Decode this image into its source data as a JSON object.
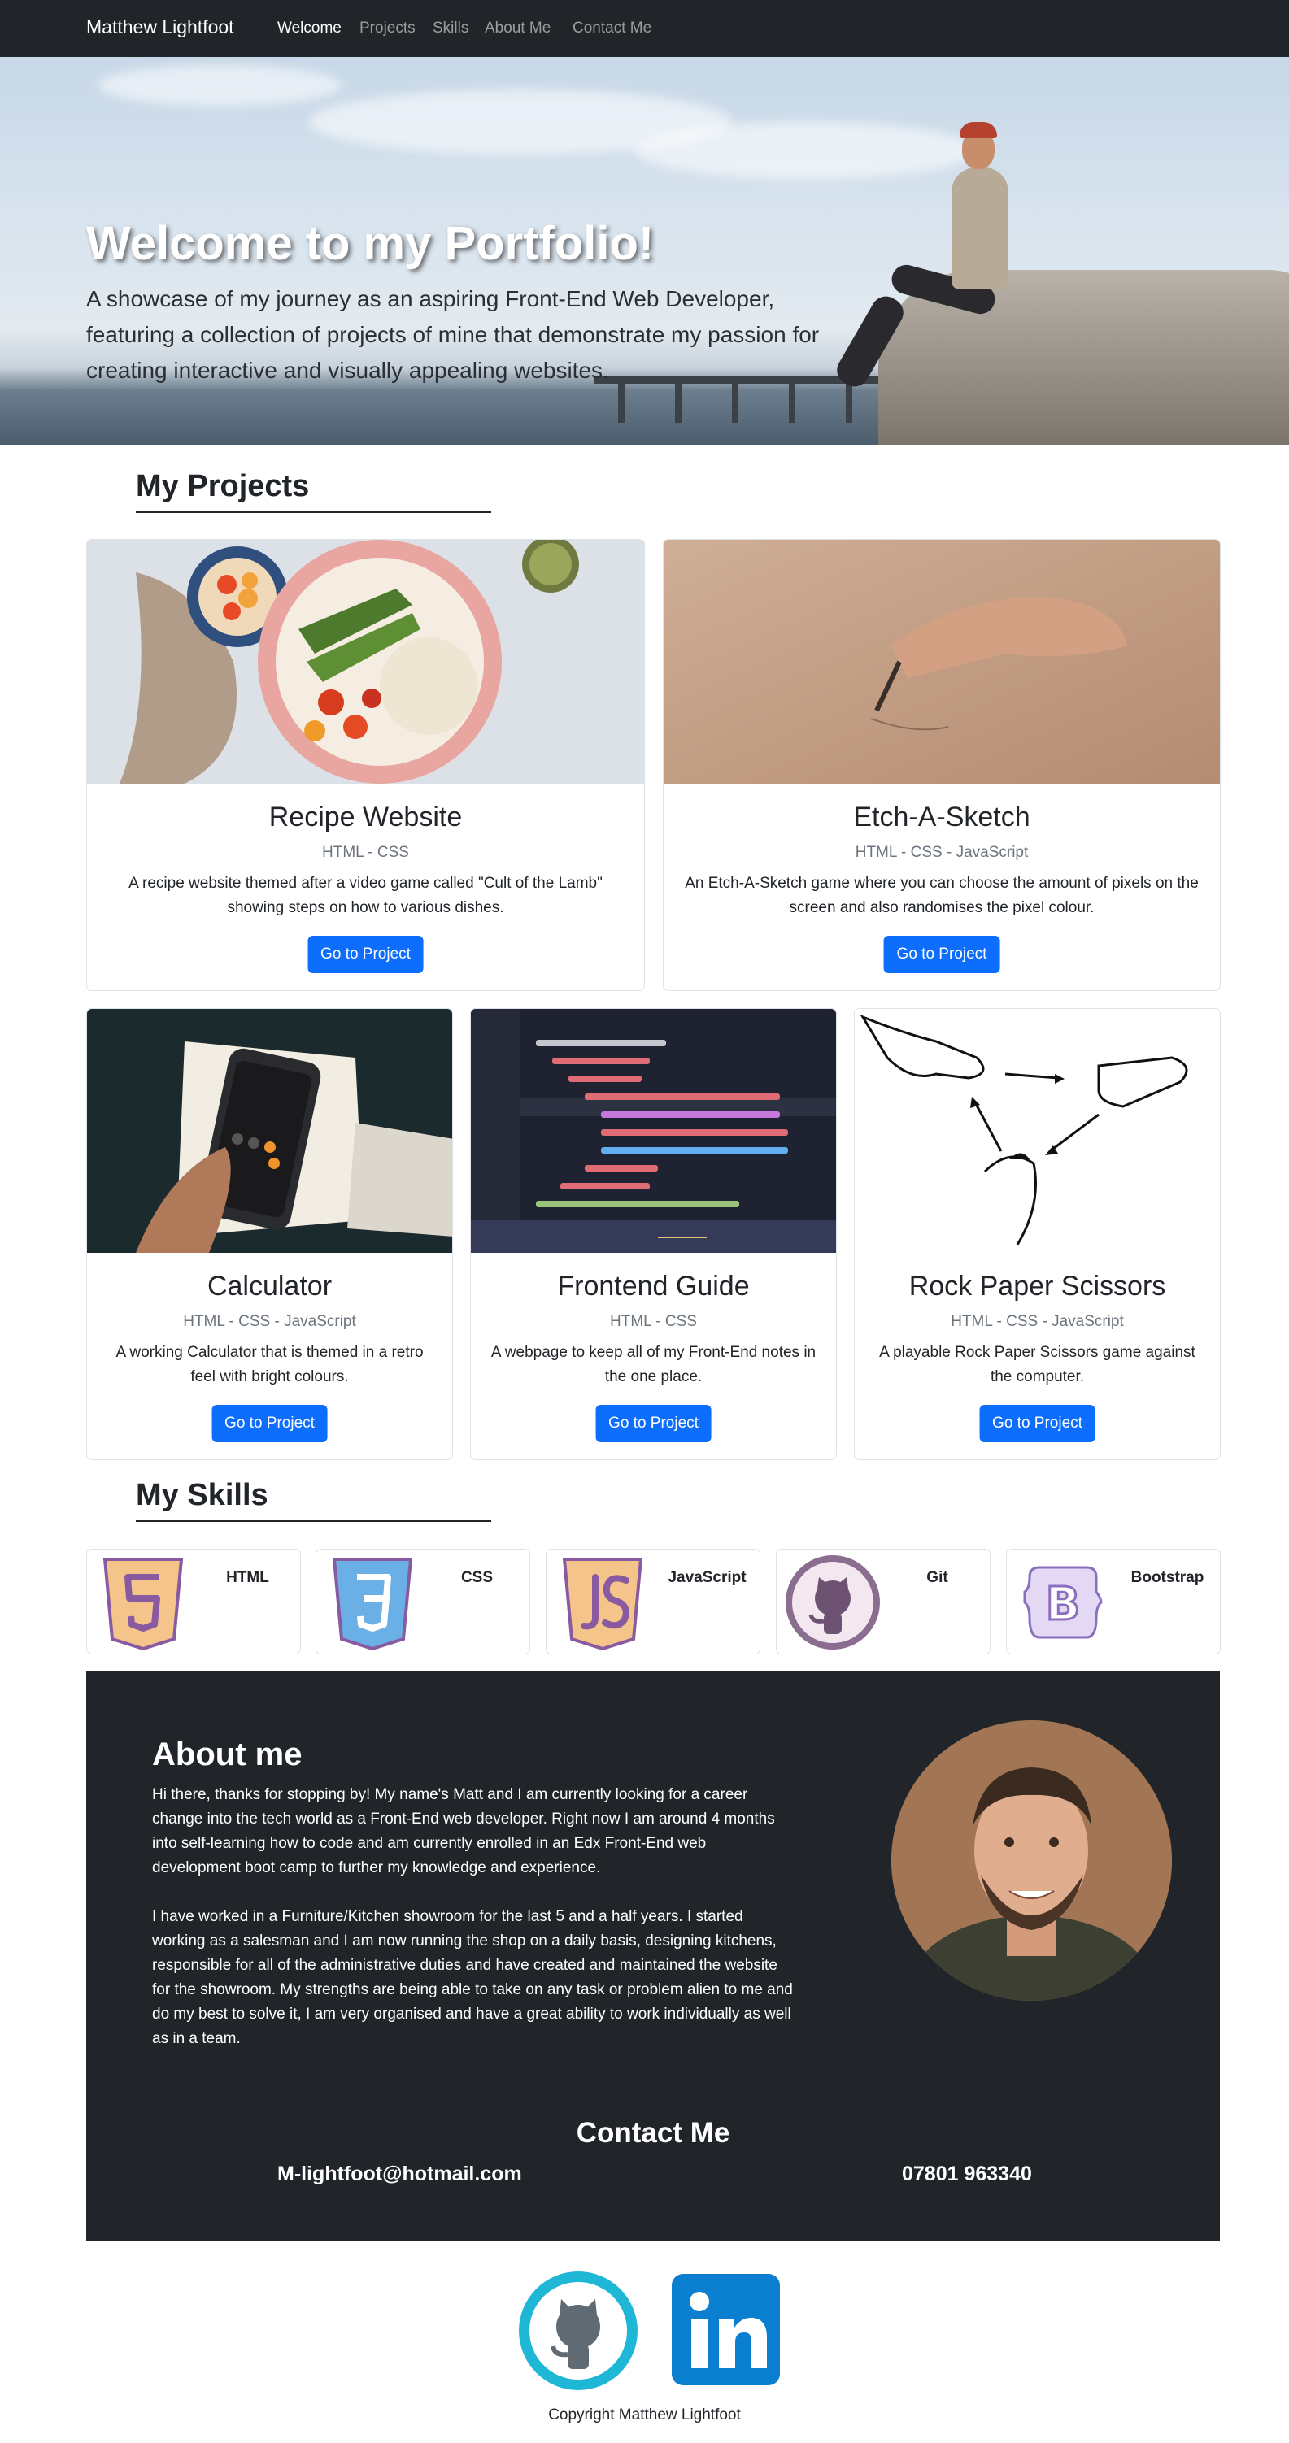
{
  "nav": {
    "brand": "Matthew Lightfoot",
    "items": [
      {
        "label": "Welcome",
        "active": true
      },
      {
        "label": "Projects",
        "active": false
      },
      {
        "label": "Skills",
        "active": false
      },
      {
        "label": "About Me",
        "active": false
      },
      {
        "label": "Contact Me",
        "active": false
      }
    ]
  },
  "hero": {
    "title": "Welcome to my Portfolio!",
    "subtitle": "A showcase of my journey as an aspiring Front-End Web Developer, featuring a collection of projects of mine that demonstrate my passion for creating interactive and visually appealing websites."
  },
  "projects": {
    "heading": "My Projects",
    "cards": [
      {
        "title": "Recipe Website",
        "tech": "HTML - CSS",
        "description": "A recipe website themed after a video game called \"Cult of the Lamb\" showing steps on how to various dishes.",
        "button": "Go to Project",
        "image": "food-bowl-photo"
      },
      {
        "title": "Etch-A-Sketch",
        "tech": "HTML - CSS - JavaScript",
        "description": "An Etch-A-Sketch game where you can choose the amount of pixels on the screen and also randomises the pixel colour.",
        "button": "Go to Project",
        "image": "hand-drawing-sand-photo"
      },
      {
        "title": "Calculator",
        "tech": "HTML - CSS - JavaScript",
        "description": "A working Calculator that is themed in a retro feel with bright colours.",
        "button": "Go to Project",
        "image": "phone-calculator-photo"
      },
      {
        "title": "Frontend Guide",
        "tech": "HTML - CSS",
        "description": "A webpage to keep all of my Front-End notes in the one place.",
        "button": "Go to Project",
        "image": "code-editor-photo"
      },
      {
        "title": "Rock Paper Scissors",
        "tech": "HTML - CSS - JavaScript",
        "description": "A playable Rock Paper Scissors game against the computer.",
        "button": "Go to Project",
        "image": "hands-rps-drawing"
      }
    ]
  },
  "skills": {
    "heading": "My Skills",
    "items": [
      {
        "name": "HTML",
        "icon": "html5-icon"
      },
      {
        "name": "CSS",
        "icon": "css3-icon"
      },
      {
        "name": "JavaScript",
        "icon": "js-icon"
      },
      {
        "name": "Git",
        "icon": "github-octocat-icon"
      },
      {
        "name": "Bootstrap",
        "icon": "bootstrap-icon"
      }
    ]
  },
  "about": {
    "heading": "About me",
    "paragraph1": "Hi there, thanks for stopping by! My name's Matt and I am currently looking for a career change into the tech world as a Front-End web developer. Right now I am around 4 months into self-learning how to code and am currently enrolled in an Edx Front-End web development boot camp to further my knowledge and experience.",
    "paragraph2": "I have worked in a Furniture/Kitchen showroom for the last 5 and a half years. I started working as a salesman and I am now running the shop on a daily basis, designing kitchens, responsible for all of the administrative duties and have created and maintained the website for the showroom. My strengths are being able to take on any task or problem alien to me and do my best to solve it, I am very organised and have a great ability to work individually as well as in a team."
  },
  "contact": {
    "heading": "Contact Me",
    "email": "M-lightfoot@hotmail.com",
    "phone": "07801 963340"
  },
  "footer": {
    "social": [
      {
        "name": "GitHub",
        "icon": "github-icon"
      },
      {
        "name": "LinkedIn",
        "icon": "linkedin-icon"
      }
    ],
    "copyright": "Copyright Matthew Lightfoot"
  },
  "colors": {
    "dark": "#212529",
    "primary": "#0d6efd",
    "muted": "#6c757d"
  }
}
